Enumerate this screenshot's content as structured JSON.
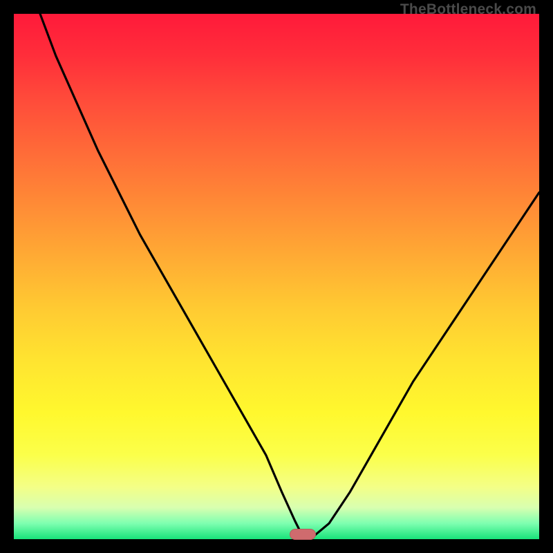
{
  "watermark": "TheBottleneck.com",
  "chart_data": {
    "type": "line",
    "title": "",
    "xlabel": "",
    "ylabel": "",
    "xlim": [
      0,
      100
    ],
    "ylim": [
      0,
      100
    ],
    "grid": false,
    "legend": false,
    "note": "Axis percentages are positions within the plot area (no tick labels are shown in the image). Curve y is estimated from pixel positions; bottom of plot = 0, top = 100. The curve touches the baseline near x≈55.",
    "series": [
      {
        "name": "curve",
        "color": "#000000",
        "x": [
          5,
          8,
          12,
          16,
          20,
          24,
          28,
          32,
          36,
          40,
          44,
          48,
          51,
          53.5,
          55,
          57,
          60,
          64,
          68,
          72,
          76,
          80,
          84,
          88,
          92,
          96,
          100
        ],
        "y": [
          100,
          92,
          83,
          74,
          66,
          58,
          51,
          44,
          37,
          30,
          23,
          16,
          9,
          3.5,
          0.5,
          0.5,
          3,
          9,
          16,
          23,
          30,
          36,
          42,
          48,
          54,
          60,
          66
        ]
      }
    ],
    "marker": {
      "x": 55,
      "y": 0.9,
      "color": "#cf6b6e",
      "shape": "pill"
    },
    "background_gradient": {
      "direction": "top-to-bottom",
      "stops": [
        {
          "pos": 0,
          "color": "#ff1a3a"
        },
        {
          "pos": 50,
          "color": "#ffb433"
        },
        {
          "pos": 80,
          "color": "#fff82e"
        },
        {
          "pos": 100,
          "color": "#18e37a"
        }
      ]
    }
  }
}
